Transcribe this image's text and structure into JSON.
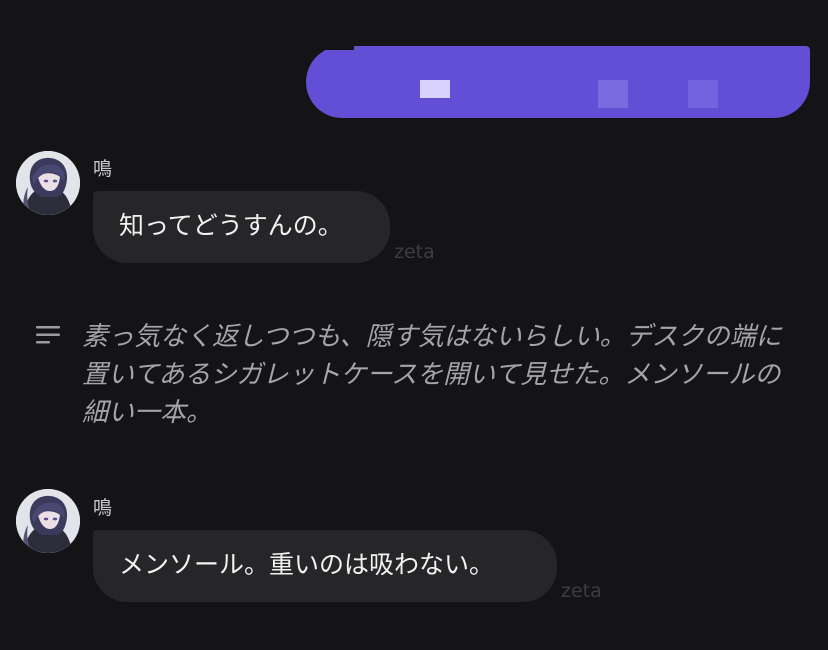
{
  "chat": {
    "messages": [
      {
        "role": "user",
        "redacted": true
      },
      {
        "role": "bot",
        "sender": "鳴",
        "text": "知ってどうすんの。",
        "source": "zeta",
        "avatar_icon": "character-avatar-icon"
      },
      {
        "role": "narration",
        "icon": "narration-lines-icon",
        "text": "素っ気なく返しつつも、隠す気はないらしい。デスクの端に置いてあるシガレットケースを開いて見せた。メンソールの細い一本。"
      },
      {
        "role": "bot",
        "sender": "鳴",
        "text": "メンソール。重いのは吸わない。",
        "source": "zeta",
        "avatar_icon": "character-avatar-icon"
      }
    ]
  },
  "colors": {
    "background": "#141416",
    "user_bubble": "#624fd6",
    "bot_bubble": "#262629",
    "bot_text": "#f2f2f3",
    "narration_text": "#a4a4aa",
    "sender_text": "#c9c9cc",
    "source_tag": "#3c3c41"
  }
}
